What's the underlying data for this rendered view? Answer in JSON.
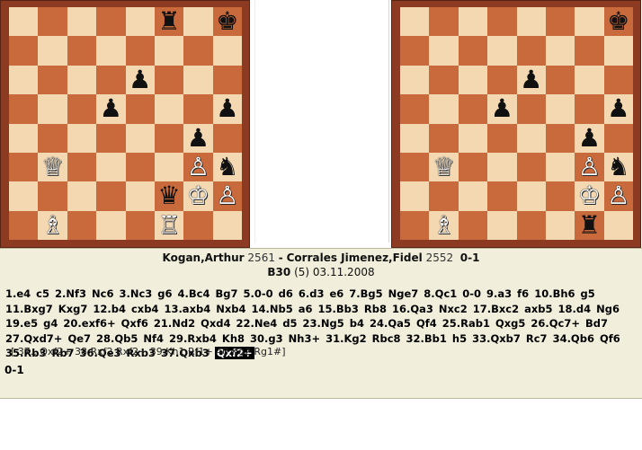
{
  "boards": {
    "left": [
      {
        "sq": "f8",
        "piece": "♜",
        "color": "black",
        "name": "black-rook-icon"
      },
      {
        "sq": "h8",
        "piece": "♚",
        "color": "black",
        "name": "black-king-icon"
      },
      {
        "sq": "e6",
        "piece": "♟",
        "color": "black",
        "name": "black-pawn-icon"
      },
      {
        "sq": "d5",
        "piece": "♟",
        "color": "black",
        "name": "black-pawn-icon"
      },
      {
        "sq": "h5",
        "piece": "♟",
        "color": "black",
        "name": "black-pawn-icon"
      },
      {
        "sq": "g4",
        "piece": "♟",
        "color": "black",
        "name": "black-pawn-icon"
      },
      {
        "sq": "b3",
        "piece": "♕",
        "color": "white",
        "name": "white-queen-icon"
      },
      {
        "sq": "g3",
        "piece": "♙",
        "color": "white",
        "name": "white-pawn-icon"
      },
      {
        "sq": "h3",
        "piece": "♞",
        "color": "black",
        "name": "black-knight-icon"
      },
      {
        "sq": "f2",
        "piece": "♛",
        "color": "black",
        "name": "black-queen-icon"
      },
      {
        "sq": "g2",
        "piece": "♔",
        "color": "white",
        "name": "white-king-icon"
      },
      {
        "sq": "h2",
        "piece": "♙",
        "color": "white",
        "name": "white-pawn-icon"
      },
      {
        "sq": "b1",
        "piece": "♗",
        "color": "white",
        "name": "white-bishop-icon"
      },
      {
        "sq": "f1",
        "piece": "♖",
        "color": "white",
        "name": "white-rook-icon"
      }
    ],
    "right": [
      {
        "sq": "h8",
        "piece": "♚",
        "color": "black",
        "name": "black-king-icon"
      },
      {
        "sq": "e6",
        "piece": "♟",
        "color": "black",
        "name": "black-pawn-icon"
      },
      {
        "sq": "d5",
        "piece": "♟",
        "color": "black",
        "name": "black-pawn-icon"
      },
      {
        "sq": "h5",
        "piece": "♟",
        "color": "black",
        "name": "black-pawn-icon"
      },
      {
        "sq": "g4",
        "piece": "♟",
        "color": "black",
        "name": "black-pawn-icon"
      },
      {
        "sq": "b3",
        "piece": "♕",
        "color": "white",
        "name": "white-queen-icon"
      },
      {
        "sq": "g3",
        "piece": "♙",
        "color": "white",
        "name": "white-pawn-icon"
      },
      {
        "sq": "h3",
        "piece": "♞",
        "color": "black",
        "name": "black-knight-icon"
      },
      {
        "sq": "g2",
        "piece": "♔",
        "color": "white",
        "name": "white-king-icon"
      },
      {
        "sq": "h2",
        "piece": "♙",
        "color": "white",
        "name": "white-pawn-icon"
      },
      {
        "sq": "b1",
        "piece": "♗",
        "color": "white",
        "name": "white-bishop-icon"
      },
      {
        "sq": "g1",
        "piece": "♜",
        "color": "black",
        "name": "black-rook-icon"
      }
    ]
  },
  "colors": {
    "light_square": "#f3d8b2",
    "dark_square": "#c96a3c",
    "frame": "#8c3a22",
    "panel": "#f1eedc"
  },
  "game": {
    "white_player": "Kogan,Arthur",
    "white_rating": "2561",
    "separator": "-",
    "black_player": "Corrales Jimenez,Fidel",
    "black_rating": "2552",
    "result": "0-1",
    "eco": "B30",
    "round": "(5)",
    "date": "03.11.2008",
    "moves_text": "1.e4  c5  2.Nf3  Nc6  3.Nc3  g6  4.Bc4  Bg7  5.0-0  d6  6.d3  e6  7.Bg5  Nge7  8.Qc1  0-0  9.a3  f6  10.Bh6  g5  11.Bxg7  Kxg7  12.b4  cxb4  13.axb4  Nxb4  14.Nb5  a6  15.Bb3  Rb8  16.Qa3  Nxc2  17.Bxc2  axb5  18.d4  Ng6  19.e5  g4  20.exf6+  Qxf6  21.Nd2  Qxd4  22.Ne4  d5  23.Ng5  b4  24.Qa5  Qf4  25.Rab1  Qxg5  26.Qc7+  Bd7  27.Qxd7+  Qe7  28.Qb5  Nf4  29.Rxb4  Kh8  30.g3  Nh3+  31.Kg2  Rbc8  32.Bb1  h5  33.Qxb7  Rc7  34.Qb6  Qf6  35.Rb3  Rb7  36.Qe3  Rxb3  37.Qxb3",
    "current_move": "Qxf2+",
    "variation": "[ 37...Qxf2+  38.Rxf2  Rxf2+  39.Kh1  Rf1+  40.Kg2  Rg1#]",
    "final_result": "0-1"
  }
}
